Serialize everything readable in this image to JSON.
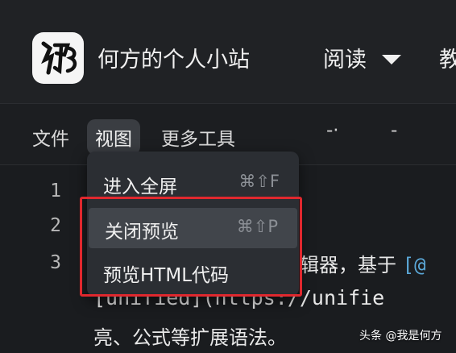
{
  "header": {
    "site_title": "何方的个人小站",
    "nav_read": "阅读",
    "nav_more_partial": "教",
    "logo_icon": "calligraphy-logo-icon"
  },
  "menubar": {
    "file": "文件",
    "view": "视图",
    "tools": "更多工具",
    "mark_a": "-·",
    "mark_b": "-"
  },
  "dropdown": {
    "items": [
      {
        "label": "进入全屏",
        "shortcut": "⌘⇧F",
        "active": false
      },
      {
        "label": "关闭预览",
        "shortcut": "⌘⇧P",
        "active": true
      },
      {
        "label": "预览HTML代码",
        "shortcut": "",
        "active": false
      }
    ]
  },
  "editor": {
    "line_numbers": [
      "1",
      "2",
      "3"
    ],
    "line3_visible": "辑器，基于",
    "line3_link": "[",
    "line3_tail": "@",
    "line4_visible": "[unified](https://unifie",
    "line5_visible": "亮、公式等扩展语法。"
  },
  "watermark": {
    "text": "头条 @我是何方"
  },
  "colors": {
    "background": "#1a1c1f",
    "highlight": "#e0282e",
    "dropdown_bg": "#2b2e33",
    "active_item_bg": "#41454b"
  }
}
